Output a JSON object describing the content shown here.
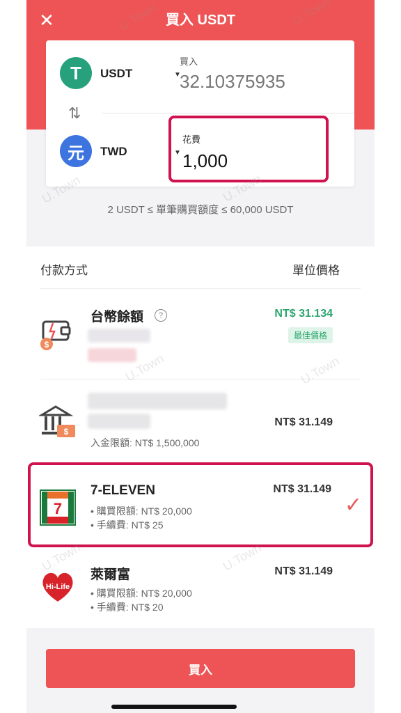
{
  "header": {
    "title": "買入 USDT",
    "close_icon": "close-icon"
  },
  "exchange": {
    "buy_currency": "USDT",
    "buy_currency_glyph": "T",
    "buy_label": "買入",
    "buy_amount": "32.10375935",
    "spend_currency": "TWD",
    "spend_currency_glyph": "元",
    "spend_label": "花費",
    "spend_amount": "1,000",
    "swap_icon": "swap-arrows-icon"
  },
  "limit_text": "2 USDT ≤ 單筆購買額度 ≤ 60,000 USDT",
  "payment": {
    "header_method": "付款方式",
    "header_price": "單位價格",
    "methods": [
      {
        "name": "台幣餘額",
        "price": "NT$ 31.134",
        "badge": "最佳價格",
        "help_icon": "?"
      },
      {
        "name": "",
        "price": "NT$ 31.149",
        "detail1": "入金限額: NT$ 1,500,000"
      },
      {
        "name": "7-ELEVEN",
        "price": "NT$ 31.149",
        "detail1": "• 購買限額: NT$ 20,000",
        "detail2": "• 手續費: NT$ 25",
        "selected": true
      },
      {
        "name": "萊爾富",
        "price": "NT$ 31.149",
        "detail1": "• 購買限額: NT$ 20,000",
        "detail2": "• 手續費: NT$ 20"
      }
    ]
  },
  "buy_button": "買入",
  "watermark": "U.Town",
  "colors": {
    "primary": "#ee5455",
    "green": "#2ba66e",
    "highlight": "#d0134e",
    "usdt": "#26a17b",
    "twd": "#3d74e0"
  }
}
